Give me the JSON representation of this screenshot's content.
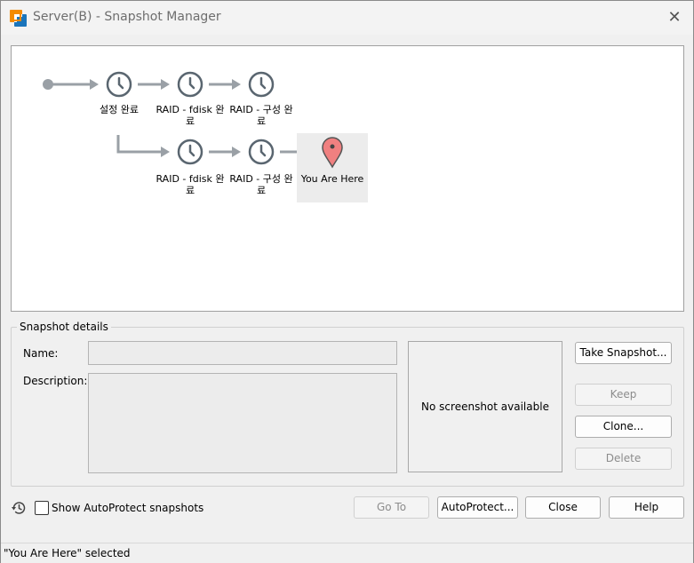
{
  "window": {
    "title": "Server(B) - Snapshot Manager",
    "close_glyph": "✕"
  },
  "tree": {
    "row1": [
      {
        "label": "설정 완료",
        "icon": "clock-icon"
      },
      {
        "label": "RAID - fdisk 완료",
        "icon": "clock-icon"
      },
      {
        "label": "RAID - 구성 완료",
        "icon": "clock-icon"
      }
    ],
    "row2": [
      {
        "label": "RAID - fdisk 완료",
        "icon": "clock-icon"
      },
      {
        "label": "RAID - 구성 완료",
        "icon": "clock-icon"
      }
    ],
    "current": {
      "label": "You Are Here",
      "icon": "location-pin-icon"
    }
  },
  "details": {
    "group_title": "Snapshot details",
    "name_label": "Name:",
    "name_value": "",
    "description_label": "Description:",
    "description_value": "",
    "preview_text": "No screenshot available"
  },
  "buttons": {
    "take_snapshot": "Take Snapshot...",
    "keep": "Keep",
    "clone": "Clone...",
    "delete": "Delete",
    "go_to": "Go To",
    "autoprotect": "AutoProtect...",
    "close": "Close",
    "help": "Help"
  },
  "autoprotect": {
    "checkbox_label": "Show AutoProtect snapshots",
    "checked": false
  },
  "status": {
    "text": "\"You Are Here\" selected"
  },
  "colors": {
    "clock": "#5a6670",
    "arrow": "#9aa0a6",
    "pin": "#f08080",
    "pin_outline": "#555555",
    "vmware_orange": "#f38b00",
    "vmware_blue": "#1b75bb"
  }
}
